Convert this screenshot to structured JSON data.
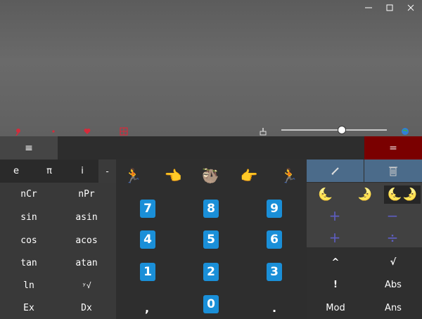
{
  "window": {
    "controls": [
      "minimize-icon",
      "maximize-icon",
      "close-icon"
    ]
  },
  "graph_toolbar": {
    "icons": [
      "pin-icon",
      "dot-icon",
      "heart-icon",
      "grid-icon"
    ],
    "right_icons": [
      "brush-icon",
      "globe-icon"
    ],
    "zoom_level": 0.57
  },
  "expression_bar": {
    "menu_label": "≡",
    "equals_label": "="
  },
  "constants": {
    "e": "e",
    "pi": "π",
    "i": "i",
    "dropdown": "-"
  },
  "functions": [
    [
      "nCr",
      "nPr"
    ],
    [
      "sin",
      "asin"
    ],
    [
      "cos",
      "acos"
    ],
    [
      "tan",
      "atan"
    ],
    [
      "ln",
      "ʸ√"
    ],
    [
      "Ex",
      "Dx"
    ]
  ],
  "keypad": {
    "emojis": [
      "🏃",
      "👈",
      "🦥",
      "👉",
      "🏃"
    ],
    "rows": [
      [
        "7",
        "8",
        "9"
      ],
      [
        "4",
        "5",
        "6"
      ],
      [
        "1",
        "2",
        "3"
      ]
    ],
    "comma": ",",
    "zero": "0",
    "dot": "."
  },
  "right_panel": {
    "moons": [
      "🌜",
      "🌛",
      "🌜🌛"
    ],
    "ops": [
      "+",
      "−",
      "+",
      "÷"
    ],
    "keys": [
      [
        "^",
        "√"
      ],
      [
        "!",
        "Abs"
      ],
      [
        "Mod",
        "Ans"
      ]
    ]
  },
  "colors": {
    "accent_digit": "#1a8fd8",
    "equals_bg": "#7a0000",
    "tool_header_bg": "#4b6b8a",
    "operator_color": "#5d5dc0"
  }
}
